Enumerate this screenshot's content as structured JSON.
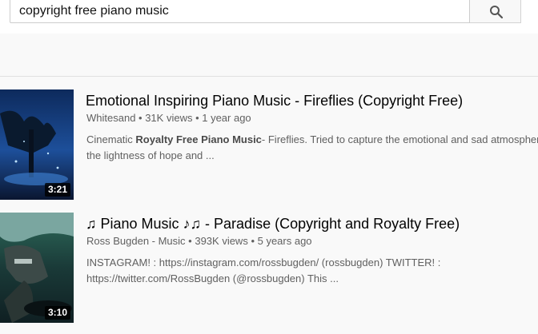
{
  "search": {
    "query": "copyright free piano music"
  },
  "icons": {
    "search_button": "search-icon"
  },
  "results": [
    {
      "title": "Emotional Inspiring Piano Music - Fireflies (Copyright Free)",
      "channel": "Whitesand",
      "views": "31K views",
      "age": "1 year ago",
      "duration": "3:21",
      "desc_prefix": "Cinematic ",
      "desc_bold": "Royalty Free Piano Music",
      "desc_suffix": "- Fireflies. Tried to capture the emotional and sad atmosphere,",
      "desc_line2": "the lightness of hope and ..."
    },
    {
      "title": "♫ Piano Music ♪♫ - Paradise (Copyright and Royalty Free)",
      "channel": "Ross Bugden - Music",
      "views": "393K views",
      "age": "5 years ago",
      "duration": "3:10",
      "desc_line1": "INSTAGRAM! : https://instagram.com/rossbugden/ (rossbugden) TWITTER! :",
      "desc_line2": "https://twitter.com/RossBugden (@rossbugden) This ..."
    }
  ],
  "separator": " • "
}
